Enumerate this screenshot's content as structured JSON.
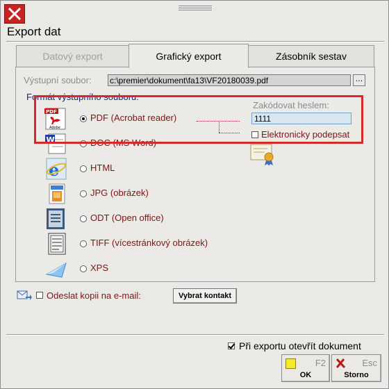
{
  "window": {
    "title": "Export dat"
  },
  "tabs": [
    {
      "label": "Datový export",
      "state": "disabled"
    },
    {
      "label": "Grafický export",
      "state": "active"
    },
    {
      "label": "Zásobník sestav",
      "state": "normal"
    }
  ],
  "output": {
    "label": "Výstupní soubor:",
    "value": "c:\\premier\\dokument\\fa13\\VF20180039.pdf",
    "browse_label": "..."
  },
  "format": {
    "heading": "Formát výstupního souboru:",
    "selected": "PDF (Acrobat reader)",
    "options": [
      {
        "label": "PDF (Acrobat reader)",
        "icon": "pdf-file-icon",
        "checked": true
      },
      {
        "label": "DOC (MS Word)",
        "icon": "word-doc-icon",
        "checked": false
      },
      {
        "label": "HTML",
        "icon": "internet-explorer-icon",
        "checked": false
      },
      {
        "label": "JPG (obrázek)",
        "icon": "jpg-image-icon",
        "checked": false
      },
      {
        "label": "ODT (Open office)",
        "icon": "odt-document-icon",
        "checked": false
      },
      {
        "label": "TIFF (vícestránkový obrázek)",
        "icon": "tiff-document-icon",
        "checked": false
      },
      {
        "label": "XPS",
        "icon": "xps-document-icon",
        "checked": false
      }
    ]
  },
  "password": {
    "label": "Zakódovat heslem:",
    "value": "1111"
  },
  "sign": {
    "label": "Elektronicky podepsat",
    "checked": false,
    "icon": "certificate-icon"
  },
  "email": {
    "label": "Odeslat kopii na e-mail:",
    "checked": false,
    "button_label": "Vybrat kontakt",
    "icon": "email-send-icon"
  },
  "open_after": {
    "label": "Při exportu otevřít dokument",
    "checked": true
  },
  "buttons": {
    "ok": {
      "label": "OK",
      "key": "F2",
      "icon": "yellow-square-icon"
    },
    "cancel": {
      "label": "Storno",
      "key": "Esc",
      "icon": "red-x-icon"
    }
  },
  "colors": {
    "highlight": "#d62a2a",
    "label_dark_red": "#7a1515",
    "heading_blue": "#18237a",
    "close_red": "#c62323"
  }
}
